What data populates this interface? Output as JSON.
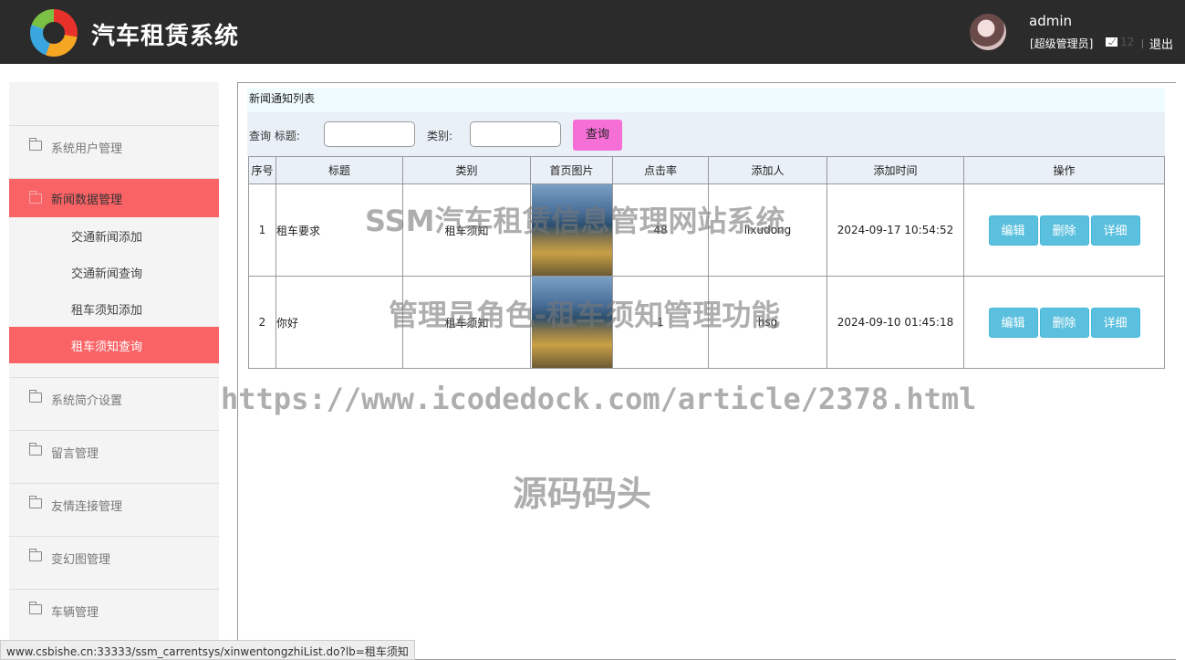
{
  "header": {
    "app_title": "汽车租赁系统",
    "username": "admin",
    "role": "[超级管理员]",
    "message_count": "12",
    "logout": "退出"
  },
  "sidebar": {
    "groups": [
      {
        "label": "系统用户管理"
      },
      {
        "label": "新闻数据管理"
      },
      {
        "label": "系统简介设置"
      },
      {
        "label": "留言管理"
      },
      {
        "label": "友情连接管理"
      },
      {
        "label": "变幻图管理"
      },
      {
        "label": "车辆管理"
      }
    ],
    "subitems": [
      {
        "label": "交通新闻添加"
      },
      {
        "label": "交通新闻查询"
      },
      {
        "label": "租车须知添加"
      },
      {
        "label": "租车须知查询"
      }
    ]
  },
  "main": {
    "panel_title": "新闻通知列表",
    "search_title_label": "查询 标题:",
    "search_category_label": "类别:",
    "search_button": "查询",
    "columns": [
      "序号",
      "标题",
      "类别",
      "首页图片",
      "点击率",
      "添加人",
      "添加时间",
      "操作"
    ],
    "rows": [
      {
        "no": "1",
        "title": "租车要求",
        "category": "租车须知",
        "clicks": "48",
        "author": "lixudong",
        "time": "2024-09-17 10:54:52"
      },
      {
        "no": "2",
        "title": "你好",
        "category": "租车须知",
        "clicks": "1",
        "author": "hsg",
        "time": "2024-09-10 01:45:18"
      }
    ],
    "actions": {
      "edit": "编辑",
      "delete": "删除",
      "detail": "详细"
    }
  },
  "watermarks": {
    "line1": "SSM汽车租赁信息管理网站系统",
    "line2": "管理员角色-租车须知管理功能",
    "line3": "https://www.icodedock.com/article/2378.html",
    "line4": "源码码头"
  },
  "statusbar": {
    "url": "www.csbishe.cn:33333/ssm_carrentsys/xinwentongzhiList.do?lb=租车须知"
  }
}
